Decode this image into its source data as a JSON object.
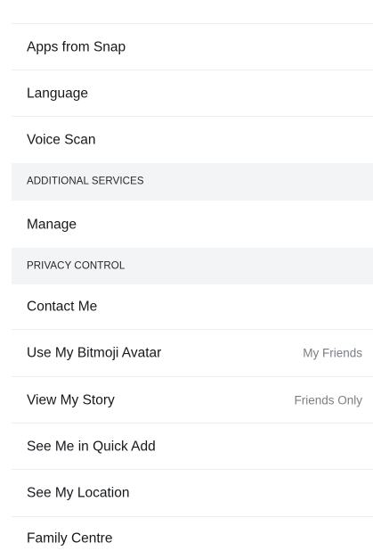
{
  "settings": {
    "items_top": [
      {
        "label": "Apps from Snap"
      },
      {
        "label": "Language"
      },
      {
        "label": "Voice Scan"
      }
    ],
    "section_additional": "ADDITIONAL SERVICES",
    "items_additional": [
      {
        "label": "Manage"
      }
    ],
    "section_privacy": "PRIVACY CONTROL",
    "items_privacy": [
      {
        "label": "Contact Me",
        "value": ""
      },
      {
        "label": "Use My Bitmoji Avatar",
        "value": "My Friends"
      },
      {
        "label": "View My Story",
        "value": "Friends Only"
      },
      {
        "label": "See Me in Quick Add",
        "value": ""
      },
      {
        "label": "See My Location",
        "value": ""
      },
      {
        "label": "Family Centre",
        "value": ""
      }
    ]
  }
}
